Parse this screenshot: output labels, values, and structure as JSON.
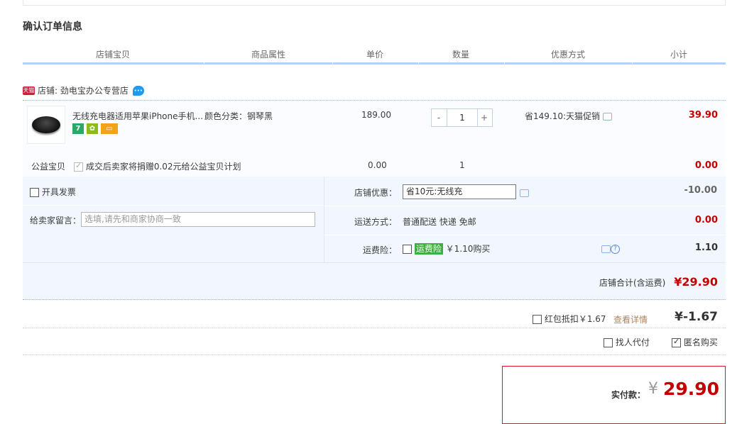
{
  "page_title": "确认订单信息",
  "headers": [
    "店铺宝贝",
    "商品属性",
    "单价",
    "数量",
    "优惠方式",
    "小计"
  ],
  "shop": {
    "badge": "天猫",
    "label": "店铺: 劲电宝办公专营店"
  },
  "item": {
    "name": "无线充电器适用苹果iPhone手机...",
    "attribute": "颜色分类：钢琴黑",
    "unit_price": "189.00",
    "quantity": "1",
    "qty_minus": "-",
    "qty_plus": "+",
    "promo": "省149.10:天猫促销",
    "subtotal": "39.90",
    "badges": [
      "7",
      "",
      ""
    ]
  },
  "charity": {
    "label": "公益宝贝",
    "text": "成交后卖家将捐赠0.02元给公益宝贝计划",
    "price": "0.00",
    "qty": "1",
    "subtotal": "0.00"
  },
  "invoice_label": "开具发票",
  "message": {
    "label": "给卖家留言：",
    "placeholder": "选填,请先和商家协商一致"
  },
  "shop_discount": {
    "label": "店铺优惠：",
    "value": "省10元:无线充",
    "amount": "-10.00"
  },
  "shipping": {
    "label": "运送方式：",
    "value": "普通配送 快递 免邮",
    "amount": "0.00"
  },
  "insurance": {
    "label": "运费险：",
    "tag": "运费险",
    "value": "￥1.10购买",
    "amount": "1.10"
  },
  "shop_total": {
    "label": "店铺合计(含运费)",
    "value": "¥29.90"
  },
  "redpacket": {
    "label": "红包抵扣￥1.67",
    "link": "查看详情",
    "amount": "¥-1.67"
  },
  "options": {
    "proxy": "找人代付",
    "anonymous": "匿名购买"
  },
  "pay": {
    "label": "实付款：",
    "currency": "¥",
    "amount": "29.90"
  },
  "colors": {
    "accent_red": "#c40000",
    "header_blue": "#b2d1ff",
    "area_bg": "#f2f7ff"
  }
}
